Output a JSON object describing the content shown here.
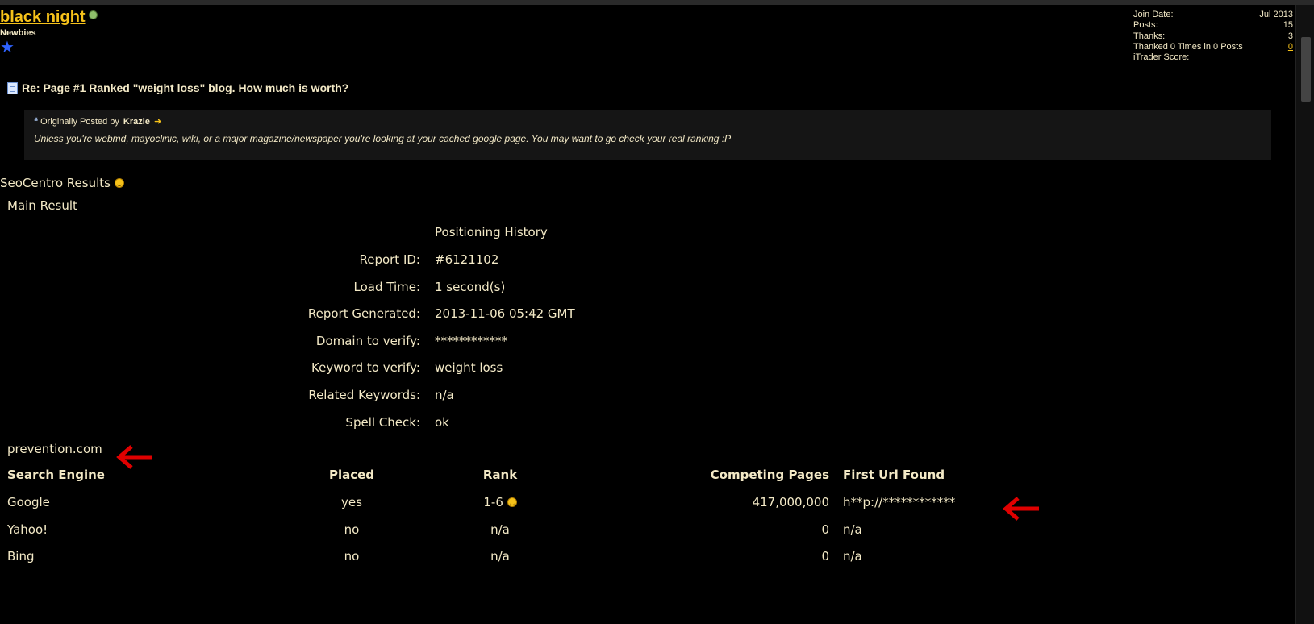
{
  "user": {
    "name": "black night",
    "title": "Newbies",
    "info": [
      {
        "label": "Join Date:",
        "value": "Jul 2013"
      },
      {
        "label": "Posts:",
        "value": "15"
      },
      {
        "label": "Thanks:",
        "value": "3"
      },
      {
        "label": "Thanked 0 Times in 0 Posts",
        "value": "0"
      },
      {
        "label": "iTrader Score:",
        "value": ""
      }
    ]
  },
  "post": {
    "title": "Re: Page #1 Ranked \"weight loss\" blog. How much is worth?"
  },
  "quote": {
    "prefix": "Originally Posted by",
    "author": "Krazie",
    "text": "Unless you're webmd, mayoclinic, wiki, or a major magazine/newspaper you're looking at your cached google page. You may want to go check your real ranking :P"
  },
  "seo": {
    "title": "SeoCentro Results",
    "main_result": "Main Result",
    "history": "Positioning History",
    "fields": [
      {
        "label": "Report ID:",
        "value": "#6121102"
      },
      {
        "label": "Load Time:",
        "value": "1 second(s)"
      },
      {
        "label": "Report Generated:",
        "value": "2013-11-06 05:42 GMT"
      },
      {
        "label": "Domain to verify:",
        "value": "************"
      },
      {
        "label": "Keyword to verify:",
        "value": "weight loss"
      },
      {
        "label": "Related Keywords:",
        "value": "n/a"
      },
      {
        "label": "Spell Check:",
        "value": "ok"
      }
    ],
    "domain": "prevention.com",
    "table": {
      "headers": [
        "Search Engine",
        "Placed",
        "Rank",
        "Competing Pages",
        "First Url Found"
      ],
      "rows": [
        [
          "Google",
          "yes",
          "1-6",
          "417,000,000",
          "h**p://************"
        ],
        [
          "Yahoo!",
          "no",
          "n/a",
          "0",
          "n/a"
        ],
        [
          "Bing",
          "no",
          "n/a",
          "0",
          "n/a"
        ]
      ]
    }
  },
  "colors": {
    "background": "#000000",
    "text": "#f3e9c6",
    "username": "#f6c21a",
    "annotation_arrow": "#e00000"
  }
}
